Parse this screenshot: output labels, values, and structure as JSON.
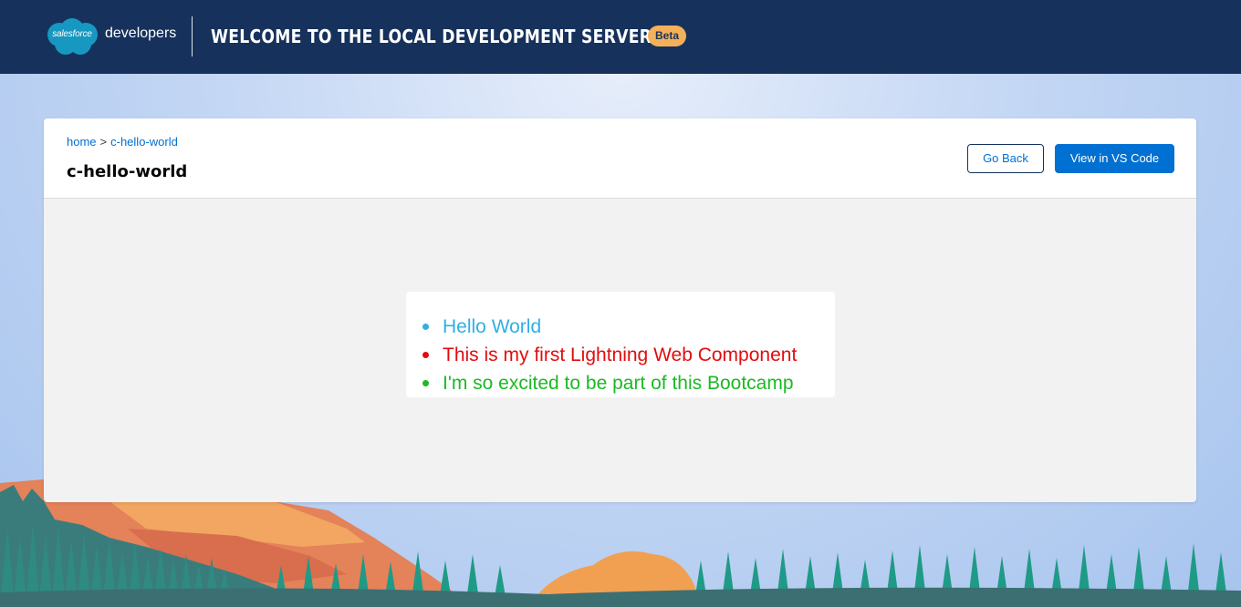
{
  "header": {
    "logo_text": "salesforce",
    "logo_sub": "developers",
    "title": "Welcome to the Local Development Server",
    "badge": "Beta"
  },
  "breadcrumb": {
    "home": "home",
    "separator": ">",
    "current": "c-hello-world"
  },
  "page_title": "c-hello-world",
  "buttons": {
    "go_back": "Go Back",
    "view_vscode": "View in VS Code"
  },
  "component": {
    "items": [
      {
        "text": "Hello World",
        "color": "#2eb0e2"
      },
      {
        "text": "This is my first Lightning Web Component",
        "color": "#e10d0d"
      },
      {
        "text": "I'm so excited to be part of this Bootcamp",
        "color": "#1cb924"
      }
    ]
  },
  "colors": {
    "header_bg": "#16325c",
    "brand_blue": "#0070d2",
    "badge": "#f4b15a"
  }
}
